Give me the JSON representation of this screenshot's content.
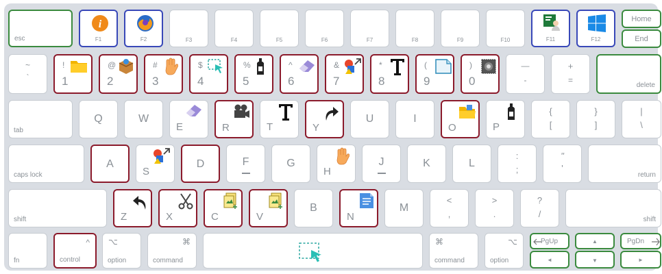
{
  "keys": {
    "esc": "esc",
    "f": [
      "F1",
      "F2",
      "F3",
      "F4",
      "F5",
      "F6",
      "F7",
      "F8",
      "F9",
      "F10",
      "F11",
      "F12"
    ],
    "home": "Home",
    "end": "End",
    "tilde_top": "~",
    "tilde_bottom": "`",
    "digits": [
      {
        "top": "!",
        "main": "1"
      },
      {
        "top": "@",
        "main": "2"
      },
      {
        "top": "#",
        "main": "3"
      },
      {
        "top": "$",
        "main": "4"
      },
      {
        "top": "%",
        "main": "5"
      },
      {
        "top": "^",
        "main": "6"
      },
      {
        "top": "&",
        "main": "7"
      },
      {
        "top": "*",
        "main": "8"
      },
      {
        "top": "(",
        "main": "9"
      },
      {
        "top": ")",
        "main": "0"
      }
    ],
    "minus_top": "—",
    "minus_bottom": "-",
    "plus_top": "+",
    "plus_bottom": "=",
    "delete": "delete",
    "tab": "tab",
    "row_q": [
      "Q",
      "W",
      "E",
      "R",
      "T",
      "Y",
      "U",
      "I",
      "O",
      "P"
    ],
    "lbrace_top": "{",
    "lbrace_bottom": "[",
    "rbrace_top": "}",
    "rbrace_bottom": "]",
    "pipe_top": "|",
    "pipe_bottom": "\\",
    "caps": "caps lock",
    "row_a": [
      "A",
      "S",
      "D",
      "F",
      "G",
      "H",
      "J",
      "K",
      "L"
    ],
    "colon_top": ":",
    "colon_bottom": ";",
    "quote_top": "\"",
    "quote_bottom": "'",
    "return": "return",
    "shift": "shift",
    "row_z": [
      "Z",
      "X",
      "C",
      "V",
      "B",
      "N",
      "M"
    ],
    "lt_top": "<",
    "lt_bottom": ",",
    "gt_top": ">",
    "gt_bottom": ".",
    "q_top": "?",
    "q_bottom": "/",
    "fn": "fn",
    "control": "control",
    "control_sym": "^",
    "option": "option",
    "option_sym": "⌥",
    "command": "command",
    "command_sym": "⌘",
    "pgup": "PgUp",
    "pgdn": "PgDn",
    "up": "▲",
    "down": "▼",
    "left": "◄",
    "right": "►"
  },
  "icons": {
    "f1": "info-icon",
    "f2": "firefox-icon",
    "f11": "presentation-icon",
    "f12": "windows-icon",
    "d1": "folder-icon",
    "d2": "package-icon",
    "d3": "hand-icon",
    "d4": "select-cursor-icon",
    "d5": "marker-icon",
    "d6": "eraser-icon",
    "d7": "shapes-icon",
    "d8": "text-icon",
    "d9": "note-icon",
    "d0": "camera-lens-icon"
  },
  "colors": {
    "red": "#8b1a2b",
    "blue": "#3848b8",
    "green": "#3a8a3e"
  }
}
